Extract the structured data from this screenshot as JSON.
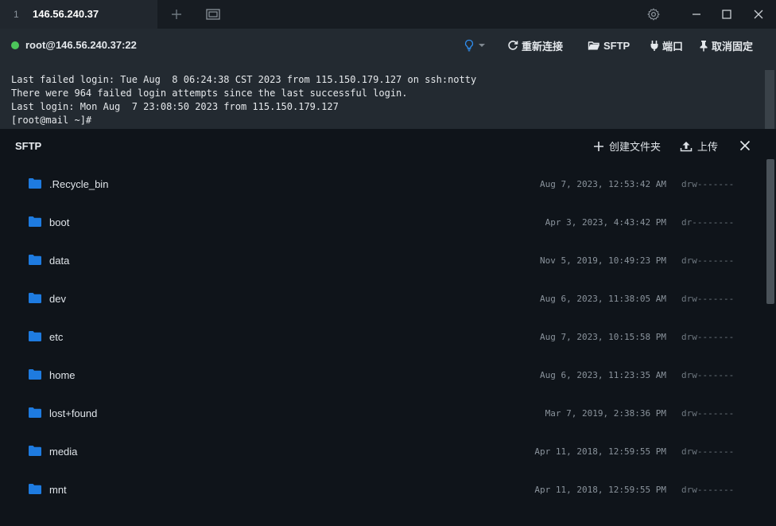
{
  "titlebar": {
    "tab_number": "1",
    "tab_title": "146.56.240.37",
    "icons": [
      "plus-icon",
      "window-icon",
      "gear-icon",
      "minimize-icon",
      "maximize-icon",
      "close-icon"
    ]
  },
  "connection": {
    "status_color": "#4cc65a",
    "host": "root@146.56.240.37:22",
    "actions": {
      "reconnect": "重新连接",
      "sftp": "SFTP",
      "port": "端口",
      "unpin": "取消固定"
    }
  },
  "terminal": {
    "lines": [
      "Last failed login: Tue Aug  8 06:24:38 CST 2023 from 115.150.179.127 on ssh:notty",
      "There were 964 failed login attempts since the last successful login.",
      "Last login: Mon Aug  7 23:08:50 2023 from 115.150.179.127",
      "[root@mail ~]#"
    ]
  },
  "sftp": {
    "title": "SFTP",
    "create_folder": "创建文件夹",
    "upload": "上传",
    "folder_color": "#1e7be0",
    "files": [
      {
        "name": ".Recycle_bin",
        "date": "Aug 7, 2023, 12:53:42 AM",
        "perm": "drw-------"
      },
      {
        "name": "boot",
        "date": "Apr 3, 2023, 4:43:42 PM",
        "perm": "dr--------"
      },
      {
        "name": "data",
        "date": "Nov 5, 2019, 10:49:23 PM",
        "perm": "drw-------"
      },
      {
        "name": "dev",
        "date": "Aug 6, 2023, 11:38:05 AM",
        "perm": "drw-------"
      },
      {
        "name": "etc",
        "date": "Aug 7, 2023, 10:15:58 PM",
        "perm": "drw-------"
      },
      {
        "name": "home",
        "date": "Aug 6, 2023, 11:23:35 AM",
        "perm": "drw-------"
      },
      {
        "name": "lost+found",
        "date": "Mar 7, 2019, 2:38:36 PM",
        "perm": "drw-------"
      },
      {
        "name": "media",
        "date": "Apr 11, 2018, 12:59:55 PM",
        "perm": "drw-------"
      },
      {
        "name": "mnt",
        "date": "Apr 11, 2018, 12:59:55 PM",
        "perm": "drw-------"
      }
    ]
  }
}
